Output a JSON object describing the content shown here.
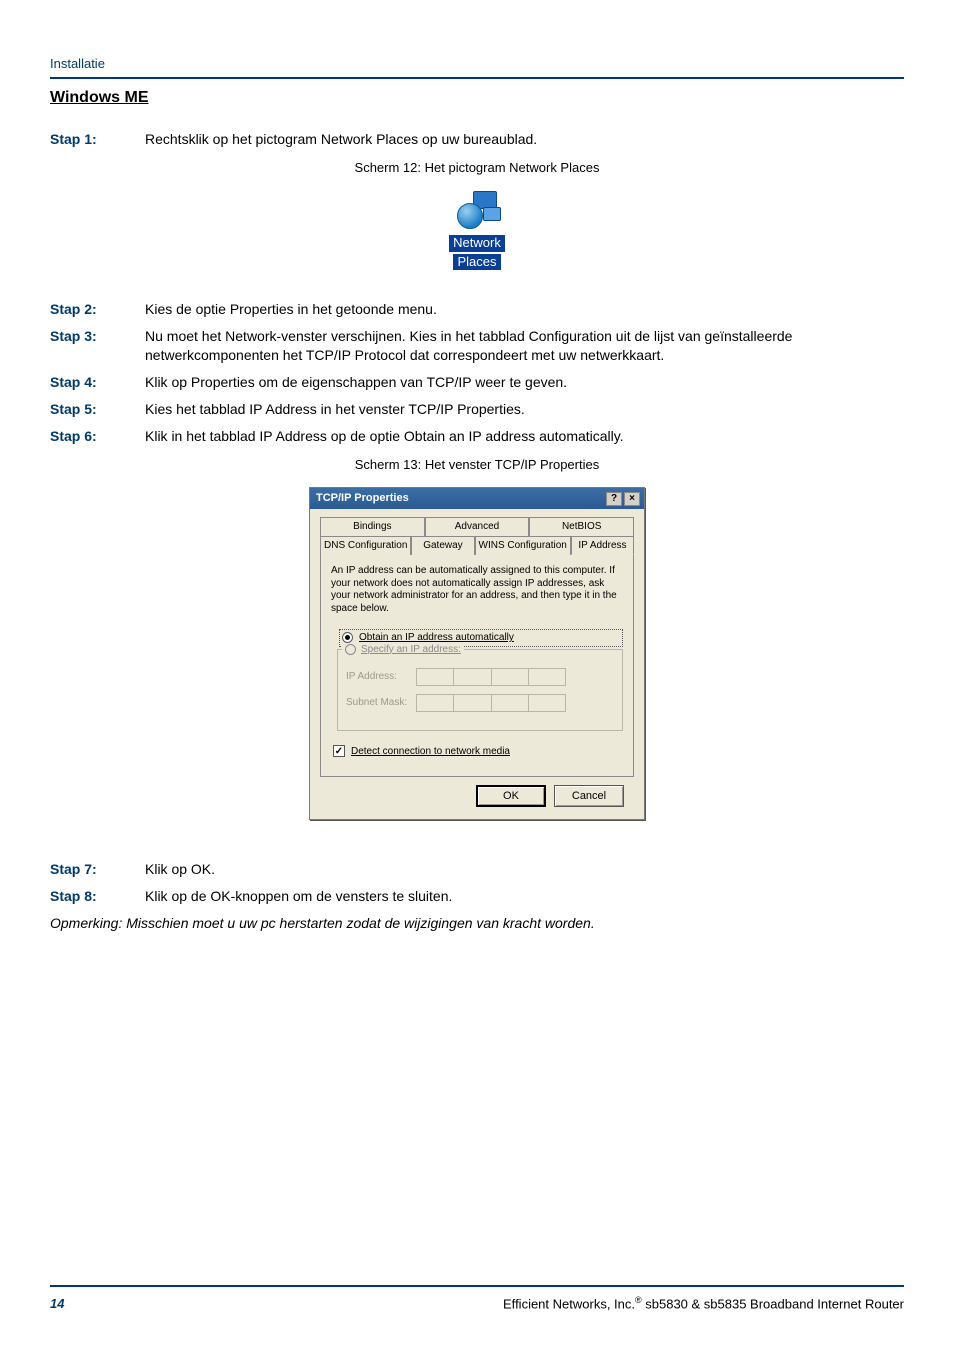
{
  "header": {
    "label": "Installatie"
  },
  "section_title": "Windows ME",
  "steps_a": [
    {
      "label": "Stap 1:",
      "text": "Rechtsklik op het pictogram Network Places op uw bureaublad."
    }
  ],
  "figure12": {
    "caption": "Scherm 12: Het pictogram Network Places",
    "icon_line1": "Network",
    "icon_line2": "Places"
  },
  "steps_b": [
    {
      "label": "Stap 2:",
      "text": "Kies de optie Properties in het getoonde menu."
    },
    {
      "label": "Stap 3:",
      "text": "Nu moet het Network-venster verschijnen. Kies in het tabblad Configuration uit de lijst van geïnstalleerde netwerkcomponenten het TCP/IP Protocol dat correspondeert met uw netwerkkaart."
    },
    {
      "label": "Stap 4:",
      "text": "Klik op Properties om de eigenschappen van TCP/IP weer te geven."
    },
    {
      "label": "Stap 5:",
      "text": "Kies het tabblad IP Address in het venster TCP/IP Properties."
    },
    {
      "label": "Stap 6:",
      "text": "Klik in het tabblad IP Address op de optie Obtain an IP address automatically."
    }
  ],
  "figure13": {
    "caption": "Scherm 13: Het venster TCP/IP Properties",
    "dialog": {
      "title": "TCP/IP Properties",
      "help_btn": "?",
      "close_btn": "×",
      "tabs_row1": [
        "Bindings",
        "Advanced",
        "NetBIOS"
      ],
      "tabs_row2": [
        "DNS Configuration",
        "Gateway",
        "WINS Configuration",
        "IP Address"
      ],
      "active_tab_index_row2": 3,
      "description": "An IP address can be automatically assigned to this computer. If your network does not automatically assign IP addresses, ask your network administrator for an address, and then type it in the space below.",
      "radio_auto": "Obtain an IP address automatically",
      "radio_specify": "Specify an IP address:",
      "field_ip_label": "IP Address:",
      "field_mask_label": "Subnet Mask:",
      "checkbox_detect": "Detect connection to network media",
      "btn_ok": "OK",
      "btn_cancel": "Cancel"
    }
  },
  "steps_c": [
    {
      "label": "Stap 7:",
      "text": "Klik op OK."
    },
    {
      "label": "Stap 8:",
      "text": "Klik op de OK-knoppen om de vensters te sluiten."
    }
  ],
  "note": "Opmerking: Misschien moet u uw pc herstarten zodat de wijzigingen van kracht worden.",
  "footer": {
    "page": "14",
    "text_left": "Efficient Networks, Inc.",
    "reg": "®",
    "text_right": " sb5830 & sb5835 Broadband Internet Router"
  }
}
